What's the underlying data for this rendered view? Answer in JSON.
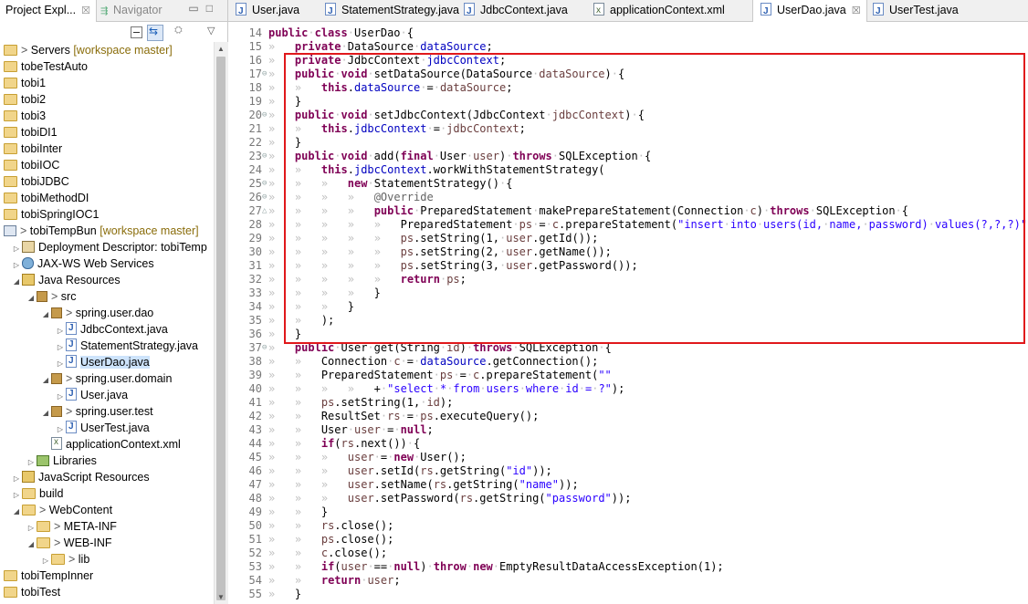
{
  "left_panel": {
    "tab_project": "Project Expl...",
    "tab_navigator": "Navigator",
    "tree": [
      {
        "label": "Servers",
        "qualifier": "[workspace master]",
        "icon": "servers-icon",
        "indent": 0,
        "deco": "> ",
        "arrow": ""
      },
      {
        "label": "tobeTestAuto",
        "icon": "folder-icon",
        "indent": 0,
        "arrow": ""
      },
      {
        "label": "tobi1",
        "icon": "folder-icon",
        "indent": 0,
        "arrow": ""
      },
      {
        "label": "tobi2",
        "icon": "folder-icon",
        "indent": 0,
        "arrow": ""
      },
      {
        "label": "tobi3",
        "icon": "folder-icon",
        "indent": 0,
        "arrow": ""
      },
      {
        "label": "tobiDI1",
        "icon": "folder-icon",
        "indent": 0,
        "arrow": ""
      },
      {
        "label": "tobiInter",
        "icon": "folder-icon",
        "indent": 0,
        "arrow": ""
      },
      {
        "label": "tobiIOC",
        "icon": "folder-icon",
        "indent": 0,
        "arrow": ""
      },
      {
        "label": "tobiJDBC",
        "icon": "folder-icon",
        "indent": 0,
        "arrow": ""
      },
      {
        "label": "tobiMethodDI",
        "icon": "folder-icon",
        "indent": 0,
        "arrow": ""
      },
      {
        "label": "tobiSpringIOC1",
        "icon": "folder-icon",
        "indent": 0,
        "arrow": ""
      },
      {
        "label": "tobiTempBun",
        "qualifier": "[workspace master]",
        "icon": "web-project-icon",
        "indent": 0,
        "deco": "> ",
        "arrow": ""
      },
      {
        "label": "Deployment Descriptor: tobiTemp",
        "icon": "deployment-descriptor-icon",
        "indent": 1,
        "arrow": "▷"
      },
      {
        "label": "JAX-WS Web Services",
        "icon": "web-services-icon",
        "indent": 1,
        "arrow": "▷"
      },
      {
        "label": "Java Resources",
        "icon": "java-resources-icon",
        "indent": 1,
        "arrow": "◢"
      },
      {
        "label": "src",
        "icon": "source-folder-icon",
        "indent": 2,
        "deco": "> ",
        "arrow": "◢"
      },
      {
        "label": "spring.user.dao",
        "icon": "package-icon",
        "indent": 3,
        "deco": "> ",
        "arrow": "◢"
      },
      {
        "label": "JdbcContext.java",
        "icon": "java-file-icon",
        "indent": 4,
        "arrow": "▷"
      },
      {
        "label": "StatementStrategy.java",
        "icon": "java-file-icon",
        "indent": 4,
        "arrow": "▷"
      },
      {
        "label": "UserDao.java",
        "icon": "java-file-icon",
        "indent": 4,
        "arrow": "▷",
        "selected": true
      },
      {
        "label": "spring.user.domain",
        "icon": "package-icon",
        "indent": 3,
        "deco": "> ",
        "arrow": "◢"
      },
      {
        "label": "User.java",
        "icon": "java-file-icon",
        "indent": 4,
        "arrow": "▷"
      },
      {
        "label": "spring.user.test",
        "icon": "package-icon",
        "indent": 3,
        "deco": "> ",
        "arrow": "◢"
      },
      {
        "label": "UserTest.java",
        "icon": "java-file-icon",
        "indent": 4,
        "arrow": "▷"
      },
      {
        "label": "applicationContext.xml",
        "icon": "xml-file-icon",
        "indent": 3,
        "arrow": ""
      },
      {
        "label": "Libraries",
        "icon": "libraries-icon",
        "indent": 2,
        "arrow": "▷"
      },
      {
        "label": "JavaScript Resources",
        "icon": "javascript-resources-icon",
        "indent": 1,
        "arrow": "▷"
      },
      {
        "label": "build",
        "icon": "folder-icon",
        "indent": 1,
        "arrow": "▷"
      },
      {
        "label": "WebContent",
        "icon": "folder-icon",
        "indent": 1,
        "deco": "> ",
        "arrow": "◢"
      },
      {
        "label": "META-INF",
        "icon": "folder-icon",
        "indent": 2,
        "deco": "> ",
        "arrow": "▷"
      },
      {
        "label": "WEB-INF",
        "icon": "folder-icon",
        "indent": 2,
        "deco": "> ",
        "arrow": "◢"
      },
      {
        "label": "lib",
        "icon": "folder-icon",
        "indent": 3,
        "deco": "> ",
        "arrow": "▷"
      },
      {
        "label": "tobiTempInner",
        "icon": "folder-icon",
        "indent": 0,
        "arrow": ""
      },
      {
        "label": "tobiTest",
        "icon": "folder-icon",
        "indent": 0,
        "arrow": ""
      }
    ]
  },
  "editor": {
    "tabs": [
      {
        "label": "User.java",
        "icon": "java-file-icon"
      },
      {
        "label": "StatementStrategy.java",
        "icon": "java-file-icon"
      },
      {
        "label": "JdbcContext.java",
        "icon": "java-file-icon"
      },
      {
        "label": "applicationContext.xml",
        "icon": "xml-file-icon"
      },
      {
        "label": "UserDao.java",
        "icon": "java-file-icon",
        "active": true
      },
      {
        "label": "UserTest.java",
        "icon": "java-file-icon"
      }
    ],
    "lines": [
      {
        "num": "14",
        "mark": "",
        "code": "public·class·UserDao·{"
      },
      {
        "num": "15",
        "mark": "",
        "code": "»   private·DataSource·dataSource;"
      },
      {
        "num": "16",
        "mark": "",
        "code": "»   private·JdbcContext·jdbcContext;"
      },
      {
        "num": "17",
        "mark": "⊖",
        "code": "»   public·void·setDataSource(DataSource·dataSource)·{"
      },
      {
        "num": "18",
        "mark": "",
        "code": "»   »   this.dataSource·=·dataSource;"
      },
      {
        "num": "19",
        "mark": "",
        "code": "»   }"
      },
      {
        "num": "20",
        "mark": "⊖",
        "code": "»   public·void·setJdbcContext(JdbcContext·jdbcContext)·{"
      },
      {
        "num": "21",
        "mark": "",
        "code": "»   »   this.jdbcContext·=·jdbcContext;"
      },
      {
        "num": "22",
        "mark": "",
        "code": "»   }"
      },
      {
        "num": "23",
        "mark": "⊖",
        "code": "»   public·void·add(final·User·user)·throws·SQLException·{"
      },
      {
        "num": "24",
        "mark": "",
        "code": "»   »   this.jdbcContext.workWithStatementStrategy("
      },
      {
        "num": "25",
        "mark": "⊖",
        "code": "»   »   »   new·StatementStrategy()·{"
      },
      {
        "num": "26",
        "mark": "⊖",
        "code": "»   »   »   »   @Override"
      },
      {
        "num": "27",
        "mark": "△",
        "code": "»   »   »   »   public·PreparedStatement·makePrepareStatement(Connection·c)·throws·SQLException·{"
      },
      {
        "num": "28",
        "mark": "",
        "code": "»   »   »   »   »   PreparedStatement·ps·=·c.prepareStatement(\"insert·into·users(id,·name,·password)·values(?,?,?)\");"
      },
      {
        "num": "29",
        "mark": "",
        "code": "»   »   »   »   »   ps.setString(1,·user.getId());"
      },
      {
        "num": "30",
        "mark": "",
        "code": "»   »   »   »   »   ps.setString(2,·user.getName());"
      },
      {
        "num": "31",
        "mark": "",
        "code": "»   »   »   »   »   ps.setString(3,·user.getPassword());"
      },
      {
        "num": "32",
        "mark": "",
        "code": "»   »   »   »   »   return·ps;"
      },
      {
        "num": "33",
        "mark": "",
        "code": "»   »   »   »   }"
      },
      {
        "num": "34",
        "mark": "",
        "code": "»   »   »   }"
      },
      {
        "num": "35",
        "mark": "",
        "code": "»   »   );"
      },
      {
        "num": "36",
        "mark": "",
        "code": "»   }"
      },
      {
        "num": "37",
        "mark": "⊖",
        "code": "»   public·User·get(String·id)·throws·SQLException·{"
      },
      {
        "num": "38",
        "mark": "",
        "code": "»   »   Connection·c·=·dataSource.getConnection();"
      },
      {
        "num": "39",
        "mark": "",
        "code": "»   »   PreparedStatement·ps·=·c.prepareStatement(\"\""
      },
      {
        "num": "40",
        "mark": "",
        "code": "»   »   »   »   +·\"select·*·from·users·where·id·=·?\");"
      },
      {
        "num": "41",
        "mark": "",
        "code": "»   »   ps.setString(1,·id);"
      },
      {
        "num": "42",
        "mark": "",
        "code": "»   »   ResultSet·rs·=·ps.executeQuery();"
      },
      {
        "num": "43",
        "mark": "",
        "code": "»   »   User·user·=·null;"
      },
      {
        "num": "44",
        "mark": "",
        "code": "»   »   if(rs.next())·{"
      },
      {
        "num": "45",
        "mark": "",
        "code": "»   »   »   user·=·new·User();"
      },
      {
        "num": "46",
        "mark": "",
        "code": "»   »   »   user.setId(rs.getString(\"id\"));"
      },
      {
        "num": "47",
        "mark": "",
        "code": "»   »   »   user.setName(rs.getString(\"name\"));"
      },
      {
        "num": "48",
        "mark": "",
        "code": "»   »   »   user.setPassword(rs.getString(\"password\"));"
      },
      {
        "num": "49",
        "mark": "",
        "code": "»   »   }"
      },
      {
        "num": "50",
        "mark": "",
        "code": "»   »   rs.close();"
      },
      {
        "num": "51",
        "mark": "",
        "code": "»   »   ps.close();"
      },
      {
        "num": "52",
        "mark": "",
        "code": "»   »   c.close();"
      },
      {
        "num": "53",
        "mark": "",
        "code": "»   »   if(user·==·null)·throw·new·EmptyResultDataAccessException(1);"
      },
      {
        "num": "54",
        "mark": "",
        "code": "»   »   return·user;"
      },
      {
        "num": "55",
        "mark": "",
        "code": "»   }"
      }
    ]
  },
  "colors": {
    "keyword": "#7f0055",
    "field": "#0000c0",
    "parameter": "#6a3e3e",
    "string": "#2a00ff",
    "annotation": "#646464",
    "whitespace_marker": "#c0c0c0",
    "highlight_border": "#e0181b"
  }
}
